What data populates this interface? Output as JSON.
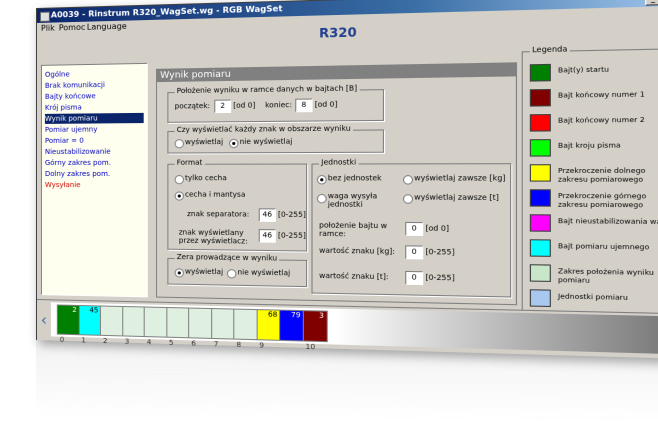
{
  "window": {
    "title": "A0039 - Rinstrum R320_WagSet.wg - RGB WagSet"
  },
  "menu": [
    "Plik",
    "Pomoc",
    "Language"
  ],
  "app_title": "R320",
  "nav": [
    {
      "label": "Ogólne"
    },
    {
      "label": "Brak komunikacji"
    },
    {
      "label": "Bajty końcowe"
    },
    {
      "label": "Krój pisma"
    },
    {
      "label": "Wynik pomiaru",
      "selected": true
    },
    {
      "label": "Pomiar ujemny"
    },
    {
      "label": "Pomiar = 0"
    },
    {
      "label": "Nieustabilizowanie"
    },
    {
      "label": "Górny zakres pom."
    },
    {
      "label": "Dolny zakres pom."
    },
    {
      "label": "Wysyłanie",
      "red": true
    }
  ],
  "panel": {
    "header": "Wynik pomiaru",
    "position": {
      "title": "Położenie wyniku w ramce danych w bajtach [B]",
      "start_label": "początek:",
      "start_value": "2",
      "start_range": "[od 0]",
      "end_label": "koniec:",
      "end_value": "8",
      "end_range": "[od 0]"
    },
    "show_all": {
      "title": "Czy wyświetlać każdy znak w obszarze wyniku",
      "yes": "wyświetlaj",
      "no": "nie wyświetlaj"
    },
    "format": {
      "title": "Format",
      "only_mantissa": "tylko cecha",
      "mantissa_fraction": "cecha i mantysa",
      "sep_label": "znak separatora:",
      "sep_value": "46",
      "sep_range": "[0-255]",
      "show_label": "znak wyświetlany przez wyświetlacz:",
      "show_value": "46",
      "show_range": "[0-255]"
    },
    "units": {
      "title": "Jednostki",
      "no_unit": "bez jednostek",
      "always_kg": "wyświetlaj zawsze [kg]",
      "weight_unit": "waga wysyła jednostki",
      "always_t": "wyświetlaj zawsze [t]",
      "byte_pos_label": "położenie bajtu w ramce:",
      "byte_pos_value": "0",
      "byte_pos_range": "[od 0]",
      "kg_label": "wartość znaku [kg]:",
      "kg_value": "0",
      "kg_range": "[0-255]",
      "t_label": "wartość znaku [t]:",
      "t_value": "0",
      "t_range": "[0-255]"
    },
    "leading_zeros": {
      "title": "Zera prowadzące w wyniku",
      "yes": "wyświetlaj",
      "no": "nie wyświetlaj"
    }
  },
  "legend": {
    "title": "Legenda",
    "items": [
      {
        "label": "Bajt(y) startu",
        "color": "#008000"
      },
      {
        "label": "Bajt końcowy numer 1",
        "color": "#800000"
      },
      {
        "label": "Bajt końcowy numer 2",
        "color": "#ff0000"
      },
      {
        "label": "Bajt kroju pisma",
        "color": "#00ff00"
      },
      {
        "label": "Przekroczenie dolnego zakresu pomiarowego",
        "color": "#ffff00"
      },
      {
        "label": "Przekroczenie górnego zakresu pomiarowego",
        "color": "#0000ff"
      },
      {
        "label": "Bajt nieustabilizowania wagi",
        "color": "#ff00ff"
      },
      {
        "label": "Bajt pomiaru ujemnego",
        "color": "#00ffff"
      },
      {
        "label": "Zakres położenia wyniku pomiaru",
        "color": "#c8e6c8"
      },
      {
        "label": "Jednostki pomiaru",
        "color": "#a8c8f0"
      }
    ]
  },
  "bytes": [
    {
      "value": "2",
      "index": "0",
      "color": "#008000"
    },
    {
      "value": "45",
      "index": "1",
      "color": "#00ffff"
    },
    {
      "value": "",
      "index": "2",
      "color": "#e0f0e0"
    },
    {
      "value": "",
      "index": "3",
      "color": "#e0f0e0"
    },
    {
      "value": "",
      "index": "4",
      "color": "#e0f0e0"
    },
    {
      "value": "",
      "index": "5",
      "color": "#e0f0e0"
    },
    {
      "value": "",
      "index": "6",
      "color": "#e0f0e0"
    },
    {
      "value": "",
      "index": "7",
      "color": "#e0f0e0"
    },
    {
      "value": "",
      "index": "8",
      "color": "#e0f0e0"
    },
    {
      "value": "68",
      "index": "9",
      "color": "#ffff00"
    },
    {
      "value": "79",
      "index": "",
      "color": "#0000ff"
    },
    {
      "value": "3",
      "index": "10",
      "color": "#800000"
    }
  ]
}
